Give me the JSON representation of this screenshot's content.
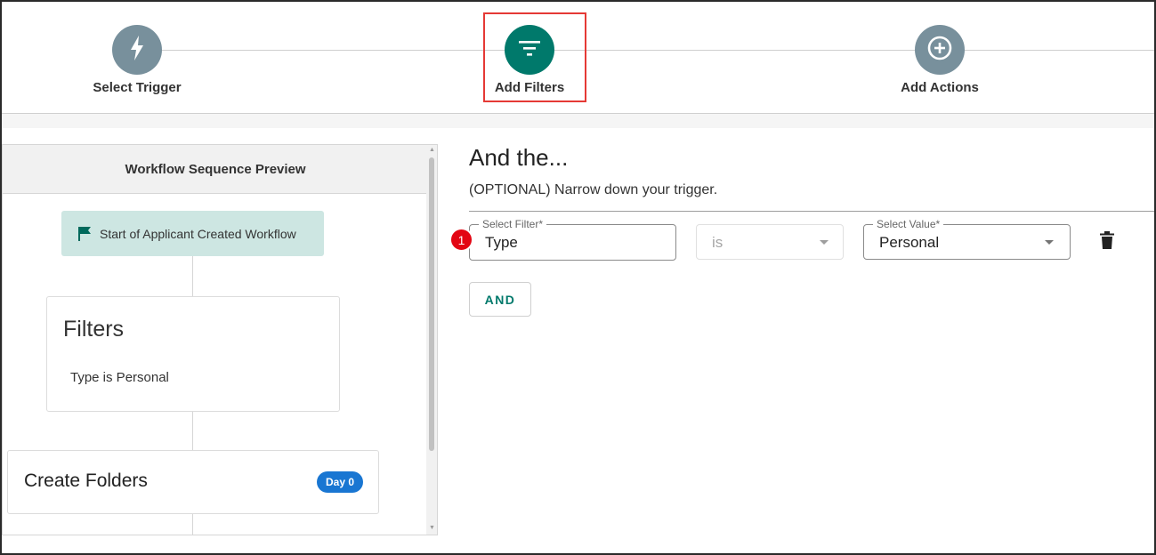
{
  "stepper": {
    "steps": [
      {
        "label": "Select Trigger",
        "icon": "bolt-icon",
        "state": "default"
      },
      {
        "label": "Add Filters",
        "icon": "filter-icon",
        "state": "active"
      },
      {
        "label": "Add Actions",
        "icon": "plus-circle-icon",
        "state": "default"
      }
    ]
  },
  "preview": {
    "header": "Workflow Sequence Preview",
    "start_node": "Start of Applicant Created Workflow",
    "filters_card": {
      "title": "Filters",
      "description": "Type is Personal"
    },
    "folders_card": {
      "title": "Create Folders",
      "badge": "Day 0"
    }
  },
  "main": {
    "heading": "And the...",
    "subheading": "(OPTIONAL) Narrow down your trigger.",
    "filter_row": {
      "step_number": "1",
      "filter_label": "Select Filter*",
      "filter_value": "Type",
      "operator_value": "is",
      "value_label": "Select Value*",
      "value_value": "Personal"
    },
    "and_button": "AND"
  },
  "colors": {
    "accent": "#00796b",
    "step_default": "#78909c",
    "highlight": "#e53935",
    "badge_blue": "#1976d2",
    "start_node_bg": "#cde6e2",
    "step_marker": "#e30613"
  }
}
